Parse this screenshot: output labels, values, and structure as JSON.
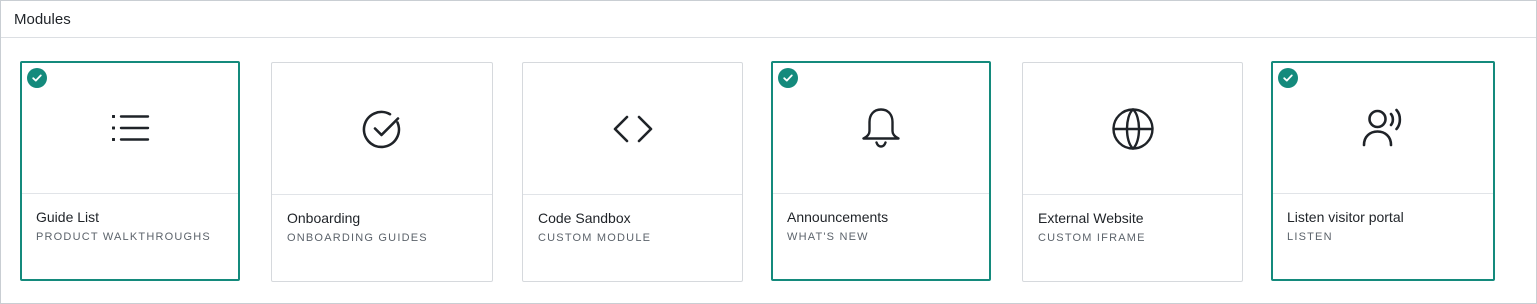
{
  "header": {
    "title": "Modules"
  },
  "accent_color": "#148a7c",
  "modules": [
    {
      "title": "Guide List",
      "subtitle": "PRODUCT WALKTHROUGHS",
      "icon": "list-icon",
      "selected": true
    },
    {
      "title": "Onboarding",
      "subtitle": "ONBOARDING GUIDES",
      "icon": "check-circle-icon",
      "selected": false
    },
    {
      "title": "Code Sandbox",
      "subtitle": "CUSTOM MODULE",
      "icon": "code-icon",
      "selected": false
    },
    {
      "title": "Announcements",
      "subtitle": "WHAT'S NEW",
      "icon": "bell-icon",
      "selected": true
    },
    {
      "title": "External Website",
      "subtitle": "CUSTOM IFRAME",
      "icon": "globe-icon",
      "selected": false
    },
    {
      "title": "Listen visitor portal",
      "subtitle": "LISTEN",
      "icon": "user-voice-icon",
      "selected": true
    }
  ]
}
